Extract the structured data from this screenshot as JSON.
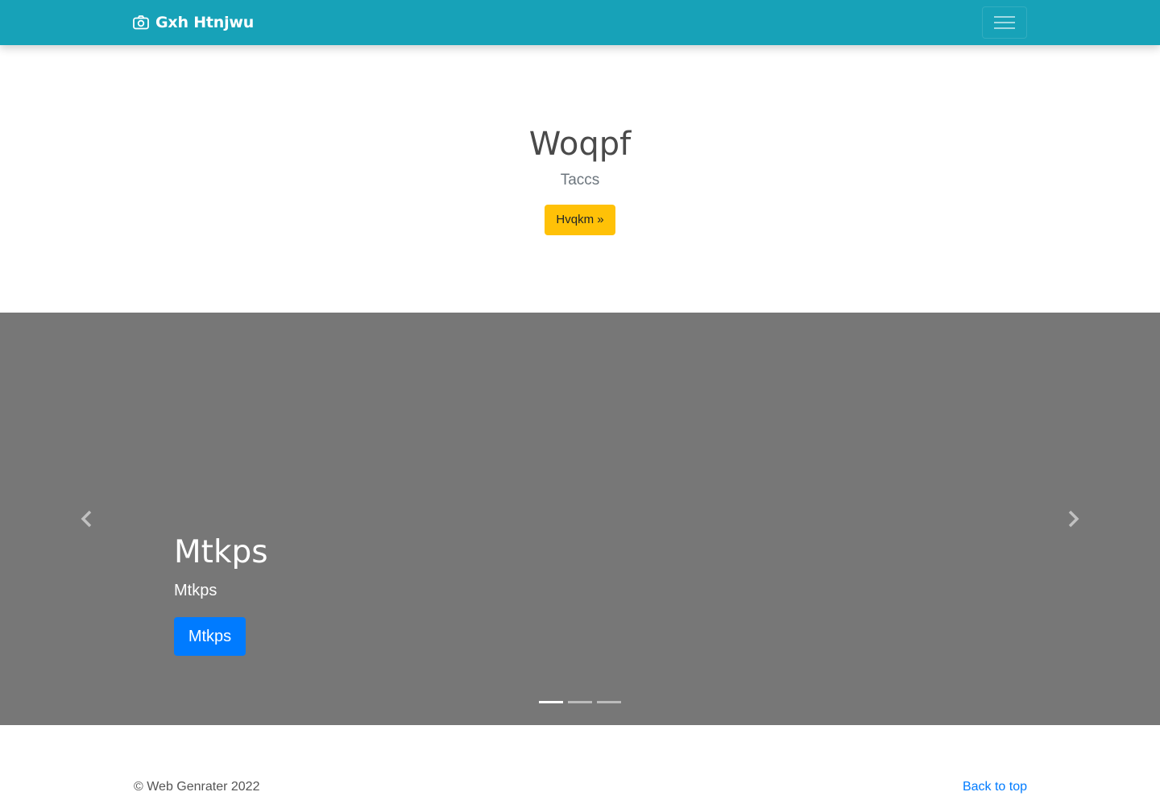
{
  "navbar": {
    "brand_icon": "camera-icon",
    "brand": "Gxh Htnjwu",
    "toggler_icon": "hamburger-menu-icon",
    "background": "#17a2b8"
  },
  "hero": {
    "title": "Woqpf",
    "subtitle": "Taccs",
    "button_label": "Hvqkm »",
    "button_color": "#ffc107"
  },
  "carousel": {
    "background": "#777777",
    "slide_title": "Mtkps",
    "slide_text": "Mtkps",
    "slide_button": "Mtkps",
    "slide_button_color": "#007bff",
    "prev_icon": "chevron-left-icon",
    "next_icon": "chevron-right-icon",
    "indicators": [
      {
        "active": true
      },
      {
        "active": false
      },
      {
        "active": false
      }
    ]
  },
  "footer": {
    "copyright": "© Web Genrater 2022",
    "back_to_top": "Back to top",
    "link_color": "#007bff"
  }
}
